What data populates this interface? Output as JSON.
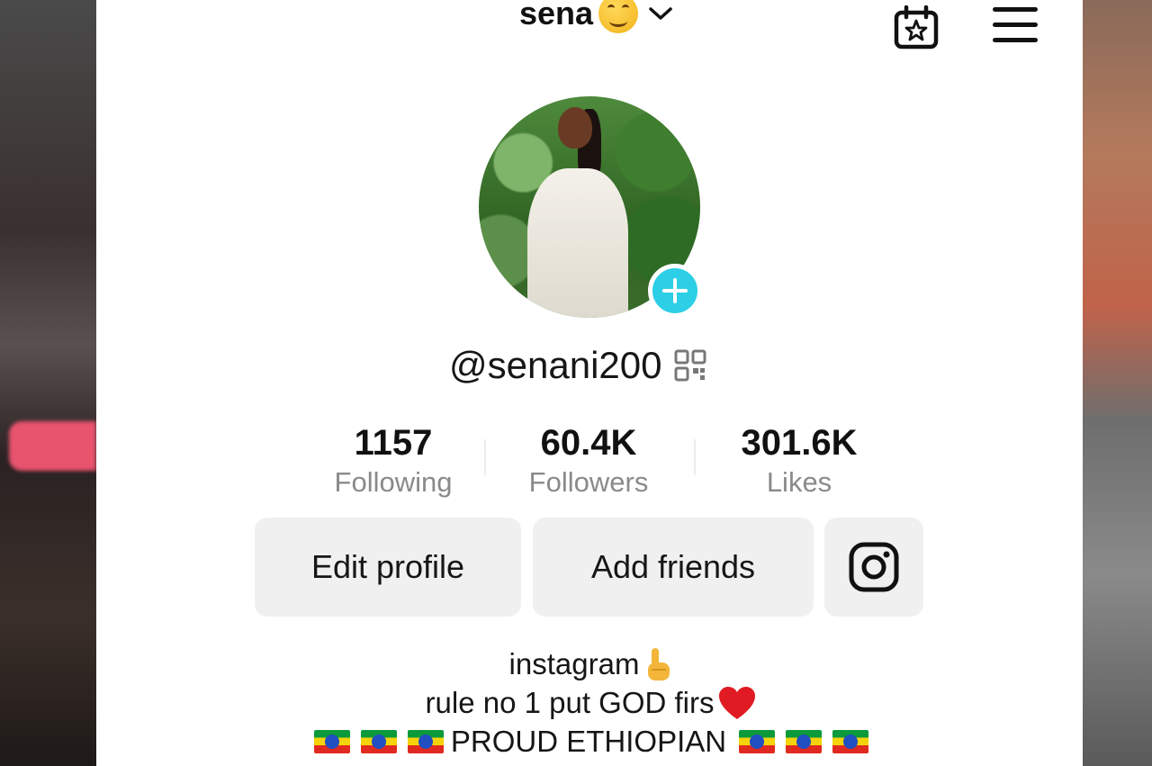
{
  "header": {
    "username": "sena",
    "emoji": "smiling-face-emoji"
  },
  "profile": {
    "handle": "@senani200"
  },
  "stats": [
    {
      "value": "1157",
      "label": "Following"
    },
    {
      "value": "60.4K",
      "label": "Followers"
    },
    {
      "value": "301.6K",
      "label": "Likes"
    }
  ],
  "actions": {
    "edit_label": "Edit profile",
    "add_friends_label": "Add friends"
  },
  "bio": {
    "line1": "instagram",
    "line2": "rule no 1 put GOD firs",
    "line3": "PROUD ETHIOPIAN"
  },
  "colors": {
    "accent": "#2ccfe6",
    "button_bg": "#f0f0f0",
    "muted_text": "#8a8a8a"
  }
}
